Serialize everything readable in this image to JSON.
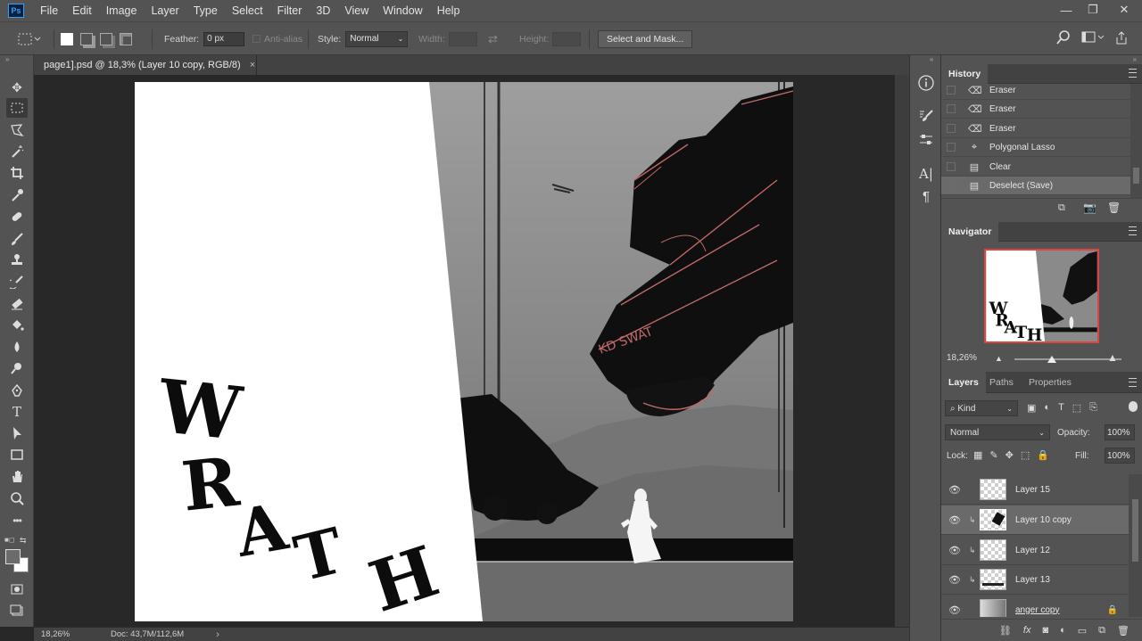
{
  "app": {
    "logo": "Ps"
  },
  "menu": [
    "File",
    "Edit",
    "Image",
    "Layer",
    "Type",
    "Select",
    "Filter",
    "3D",
    "View",
    "Window",
    "Help"
  ],
  "window_controls": {
    "minimize": "—",
    "restore": "❐",
    "close": "✕"
  },
  "options": {
    "feather_label": "Feather:",
    "feather_value": "0 px",
    "antialias_label": "Anti-alias",
    "style_label": "Style:",
    "style_value": "Normal",
    "width_label": "Width:",
    "height_label": "Height:",
    "select_mask_label": "Select and Mask..."
  },
  "document": {
    "tab_title": "page1].psd @ 18,3% (Layer 10 copy, RGB/8)",
    "close": "×"
  },
  "artwork": {
    "title_letters": [
      "W",
      "R",
      "A",
      "T",
      "H"
    ],
    "truck_text": "KD SWAT",
    "accent_color": "#c06868"
  },
  "status": {
    "zoom": "18,26%",
    "doc": "Doc: 43,7M/112,6M",
    "arrow": "›"
  },
  "history": {
    "title": "History",
    "items": [
      {
        "label": "Eraser",
        "icon": "eraser-icon"
      },
      {
        "label": "Eraser",
        "icon": "eraser-icon"
      },
      {
        "label": "Eraser",
        "icon": "eraser-icon"
      },
      {
        "label": "Polygonal Lasso",
        "icon": "polygonal-lasso-icon"
      },
      {
        "label": "Clear",
        "icon": "document-icon"
      },
      {
        "label": "Deselect (Save)",
        "icon": "document-icon"
      }
    ]
  },
  "navigator": {
    "title": "Navigator",
    "zoom": "18,26%",
    "zoom_level": 0.35
  },
  "layers": {
    "tabs": [
      "Layers",
      "Paths",
      "Properties"
    ],
    "kind_label": "Kind",
    "blend_mode": "Normal",
    "opacity_label": "Opacity:",
    "opacity_value": "100%",
    "lock_label": "Lock:",
    "fill_label": "Fill:",
    "fill_value": "100%",
    "items": [
      {
        "name": "Layer 15",
        "selected": false,
        "clipped": false
      },
      {
        "name": "Layer 10 copy",
        "selected": true,
        "clipped": true
      },
      {
        "name": "Layer 12",
        "selected": false,
        "clipped": true
      },
      {
        "name": "Layer 13",
        "selected": false,
        "clipped": true
      },
      {
        "name": "anger copy",
        "selected": false,
        "clipped": false
      }
    ]
  }
}
